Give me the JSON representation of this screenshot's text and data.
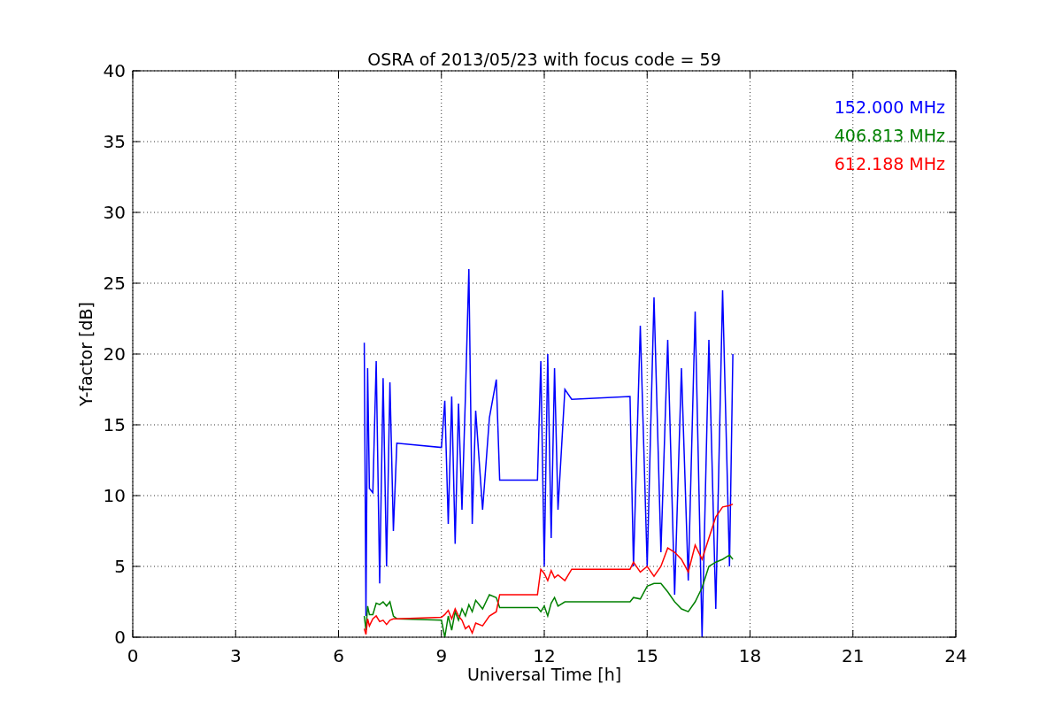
{
  "chart_data": {
    "type": "line",
    "title": "OSRA of 2013/05/23 with focus code = 59",
    "xlabel": "Universal Time [h]",
    "ylabel": "Y-factor [dB]",
    "x": [
      6.75,
      6.8,
      6.85,
      6.9,
      7.0,
      7.1,
      7.2,
      7.3,
      7.4,
      7.5,
      7.6,
      7.7,
      9.0,
      9.1,
      9.2,
      9.3,
      9.4,
      9.5,
      9.6,
      9.7,
      9.8,
      9.9,
      10.0,
      10.2,
      10.4,
      10.6,
      10.7,
      11.8,
      11.9,
      12.0,
      12.1,
      12.2,
      12.3,
      12.4,
      12.6,
      12.8,
      14.5,
      14.6,
      14.8,
      15.0,
      15.2,
      15.4,
      15.6,
      15.8,
      16.0,
      16.2,
      16.4,
      16.6,
      16.8,
      17.0,
      17.2,
      17.4,
      17.5
    ],
    "series": [
      {
        "name": "152.000 MHz",
        "color": "#0000ff",
        "values": [
          20.8,
          1.5,
          19,
          10.5,
          10.2,
          19.5,
          3.8,
          18.3,
          5,
          18,
          7.5,
          13.7,
          13.4,
          16.7,
          8,
          17,
          6.6,
          16.5,
          9,
          17,
          26,
          8,
          16,
          9,
          15.5,
          18.2,
          11.1,
          11.1,
          19.5,
          5,
          20,
          7,
          19,
          9,
          17.5,
          16.8,
          17,
          5,
          22,
          5,
          24,
          6,
          21,
          3,
          19,
          4,
          23,
          0,
          21,
          2,
          24.5,
          5,
          20
        ]
      },
      {
        "name": "406.813 MHz",
        "color": "#008000",
        "values": [
          1.5,
          0.5,
          2.2,
          1.6,
          1.6,
          2.4,
          2.3,
          2.5,
          2.2,
          2.5,
          1.5,
          1.3,
          1.2,
          0,
          1.5,
          0.5,
          1.8,
          1.2,
          2,
          1.5,
          2.3,
          1.8,
          2.6,
          2,
          3,
          2.8,
          2.1,
          2.1,
          1.8,
          2.2,
          1.5,
          2.4,
          2.8,
          2.2,
          2.5,
          2.5,
          2.5,
          2.8,
          2.7,
          3.6,
          3.8,
          3.8,
          3.2,
          2.5,
          2,
          1.8,
          2.5,
          3.5,
          5,
          5.3,
          5.5,
          5.8,
          5.5
        ]
      },
      {
        "name": "612.188 MHz",
        "color": "#ff0000",
        "values": [
          0.6,
          0.2,
          1.3,
          0.8,
          1.3,
          1.5,
          1.1,
          1.2,
          0.9,
          1.2,
          1.3,
          1.3,
          1.4,
          1.6,
          1.9,
          1.3,
          2,
          1.5,
          1.2,
          0.6,
          0.8,
          0.3,
          1,
          0.8,
          1.5,
          1.8,
          3,
          3,
          4.8,
          4.5,
          4,
          4.7,
          4.2,
          4.4,
          4,
          4.8,
          4.8,
          5.3,
          4.6,
          5,
          4.3,
          5,
          6.3,
          6,
          5.5,
          4.6,
          6.5,
          5.5,
          7,
          8.5,
          9.2,
          9.3,
          9.4
        ]
      }
    ],
    "xlim": [
      0,
      24
    ],
    "ylim": [
      0,
      40
    ],
    "xticks": [
      0,
      3,
      6,
      9,
      12,
      15,
      18,
      21,
      24
    ],
    "yticks": [
      0,
      5,
      10,
      15,
      20,
      25,
      30,
      35,
      40
    ],
    "grid": true
  }
}
